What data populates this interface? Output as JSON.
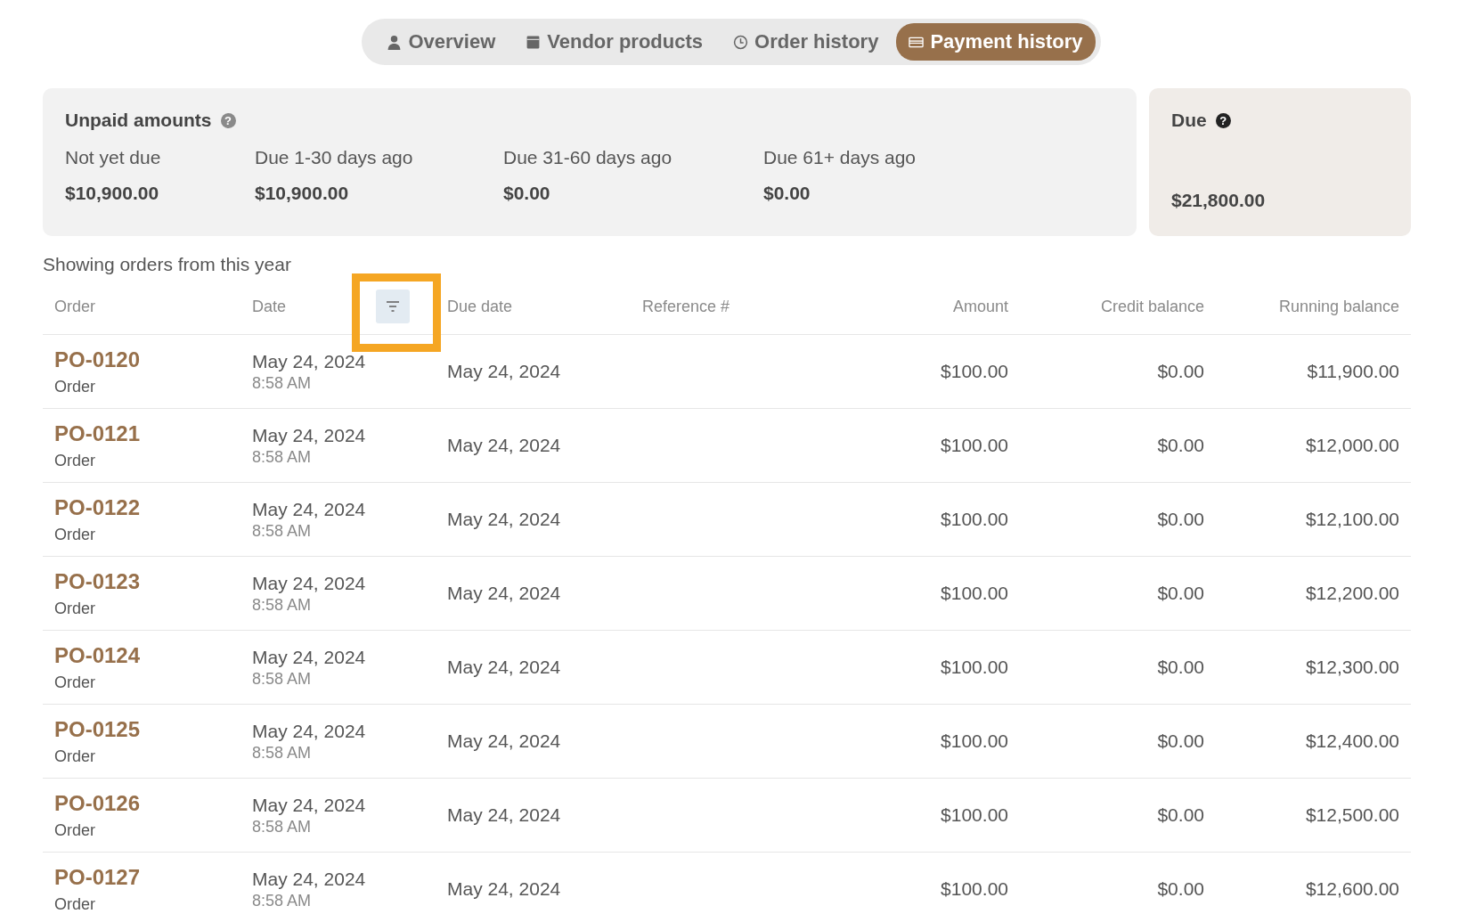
{
  "tabs": [
    {
      "label": "Overview",
      "kind": "person",
      "selected": false
    },
    {
      "label": "Vendor products",
      "kind": "box",
      "selected": false
    },
    {
      "label": "Order history",
      "kind": "clock",
      "selected": false
    },
    {
      "label": "Payment history",
      "kind": "card",
      "selected": true
    }
  ],
  "unpaid": {
    "title": "Unpaid amounts",
    "help_mark": "?",
    "buckets": [
      {
        "label": "Not yet due",
        "value": "$10,900.00"
      },
      {
        "label": "Due 1-30 days ago",
        "value": "$10,900.00"
      },
      {
        "label": "Due 31-60 days ago",
        "value": "$0.00"
      },
      {
        "label": "Due 61+ days ago",
        "value": "$0.00"
      }
    ]
  },
  "due": {
    "title": "Due",
    "help_mark": "?",
    "value": "$21,800.00"
  },
  "caption": "Showing orders from this year",
  "table": {
    "columns": [
      "Order",
      "Date",
      "Due date",
      "Reference #",
      "Amount",
      "Credit balance",
      "Running balance"
    ],
    "rows": [
      {
        "order": "PO-0120",
        "type": "Order",
        "date": "May 24, 2024",
        "time": "8:58 AM",
        "due_date": "May 24, 2024",
        "amount": "$100.00",
        "credit_balance": "$0.00",
        "running_balance": "$11,900.00"
      },
      {
        "order": "PO-0121",
        "type": "Order",
        "date": "May 24, 2024",
        "time": "8:58 AM",
        "due_date": "May 24, 2024",
        "amount": "$100.00",
        "credit_balance": "$0.00",
        "running_balance": "$12,000.00"
      },
      {
        "order": "PO-0122",
        "type": "Order",
        "date": "May 24, 2024",
        "time": "8:58 AM",
        "due_date": "May 24, 2024",
        "amount": "$100.00",
        "credit_balance": "$0.00",
        "running_balance": "$12,100.00"
      },
      {
        "order": "PO-0123",
        "type": "Order",
        "date": "May 24, 2024",
        "time": "8:58 AM",
        "due_date": "May 24, 2024",
        "amount": "$100.00",
        "credit_balance": "$0.00",
        "running_balance": "$12,200.00"
      },
      {
        "order": "PO-0124",
        "type": "Order",
        "date": "May 24, 2024",
        "time": "8:58 AM",
        "due_date": "May 24, 2024",
        "amount": "$100.00",
        "credit_balance": "$0.00",
        "running_balance": "$12,300.00"
      },
      {
        "order": "PO-0125",
        "type": "Order",
        "date": "May 24, 2024",
        "time": "8:58 AM",
        "due_date": "May 24, 2024",
        "amount": "$100.00",
        "credit_balance": "$0.00",
        "running_balance": "$12,400.00"
      },
      {
        "order": "PO-0126",
        "type": "Order",
        "date": "May 24, 2024",
        "time": "8:58 AM",
        "due_date": "May 24, 2024",
        "amount": "$100.00",
        "credit_balance": "$0.00",
        "running_balance": "$12,500.00"
      },
      {
        "order": "PO-0127",
        "type": "Order",
        "date": "May 24, 2024",
        "time": "8:58 AM",
        "due_date": "May 24, 2024",
        "amount": "$100.00",
        "credit_balance": "$0.00",
        "running_balance": "$12,600.00"
      }
    ]
  }
}
